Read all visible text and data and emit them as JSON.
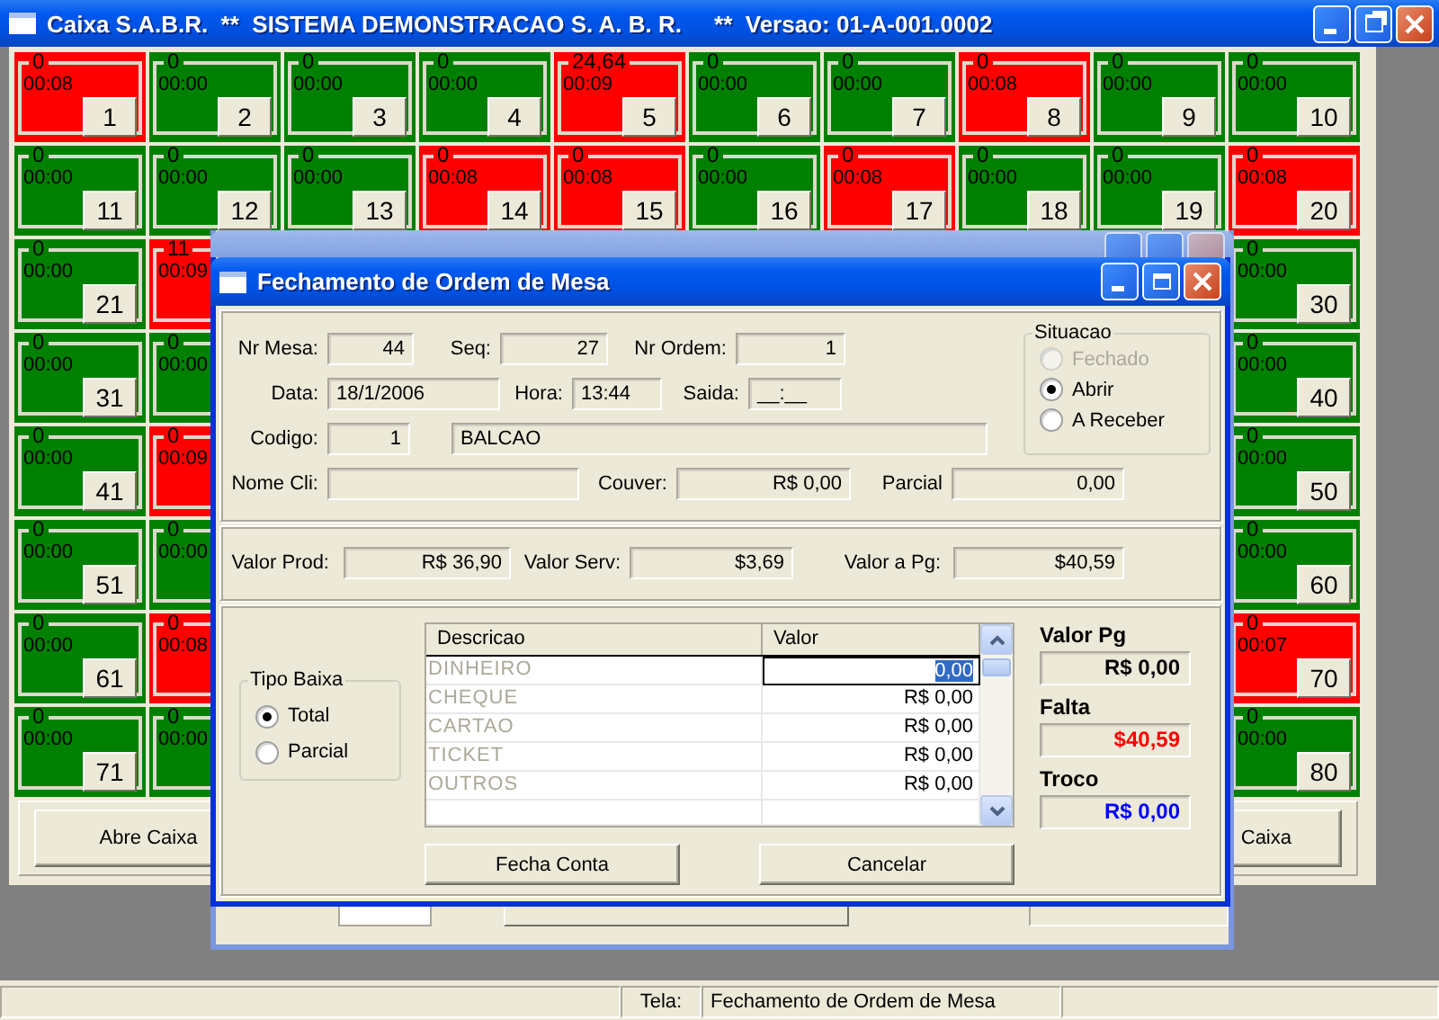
{
  "window": {
    "title": "Caixa S.A.B.R.  **  SISTEMA DEMONSTRACAO S. A. B. R.     **  Versao: 01-A-001.0002"
  },
  "table_rows": [
    {
      "tables": [
        {
          "total": "0",
          "time": "00:08",
          "number": "1",
          "color": "#ff0000"
        },
        {
          "total": "0",
          "time": "00:00",
          "number": "2",
          "color": "#008000"
        },
        {
          "total": "0",
          "time": "00:00",
          "number": "3",
          "color": "#008000"
        },
        {
          "total": "0",
          "time": "00:00",
          "number": "4",
          "color": "#008000"
        },
        {
          "total": "24,64",
          "time": "00:09",
          "number": "5",
          "color": "#ff0000"
        },
        {
          "total": "0",
          "time": "00:00",
          "number": "6",
          "color": "#008000"
        },
        {
          "total": "0",
          "time": "00:00",
          "number": "7",
          "color": "#008000"
        },
        {
          "total": "0",
          "time": "00:08",
          "number": "8",
          "color": "#ff0000"
        },
        {
          "total": "0",
          "time": "00:00",
          "number": "9",
          "color": "#008000"
        },
        {
          "total": "0",
          "time": "00:00",
          "number": "10",
          "color": "#008000"
        }
      ]
    },
    {
      "tables": [
        {
          "total": "0",
          "time": "00:00",
          "number": "11",
          "color": "#008000"
        },
        {
          "total": "0",
          "time": "00:00",
          "number": "12",
          "color": "#008000"
        },
        {
          "total": "0",
          "time": "00:00",
          "number": "13",
          "color": "#008000"
        },
        {
          "total": "0",
          "time": "00:08",
          "number": "14",
          "color": "#ff0000"
        },
        {
          "total": "0",
          "time": "00:08",
          "number": "15",
          "color": "#ff0000"
        },
        {
          "total": "0",
          "time": "00:00",
          "number": "16",
          "color": "#008000"
        },
        {
          "total": "0",
          "time": "00:08",
          "number": "17",
          "color": "#ff0000"
        },
        {
          "total": "0",
          "time": "00:00",
          "number": "18",
          "color": "#008000"
        },
        {
          "total": "0",
          "time": "00:00",
          "number": "19",
          "color": "#008000"
        },
        {
          "total": "0",
          "time": "00:08",
          "number": "20",
          "color": "#ff0000"
        }
      ]
    },
    {
      "tables": [
        {
          "total": "0",
          "time": "00:00",
          "number": "21",
          "color": "#008000"
        },
        {
          "total": "11",
          "time": "00:09",
          "color": "#ff0000"
        },
        {
          "total": "0",
          "time": "00:00",
          "number": "30",
          "color": "#008000"
        }
      ]
    },
    {
      "tables": [
        {
          "total": "0",
          "time": "00:00",
          "number": "31",
          "color": "#008000"
        },
        {
          "total": "0",
          "time": "00:00",
          "color": "#008000"
        },
        {
          "total": "0",
          "time": "00:00",
          "number": "40",
          "color": "#008000"
        }
      ]
    },
    {
      "tables": [
        {
          "total": "0",
          "time": "00:00",
          "number": "41",
          "color": "#008000"
        },
        {
          "total": "0",
          "time": "00:09",
          "color": "#ff0000"
        },
        {
          "total": "0",
          "time": "00:00",
          "number": "50",
          "color": "#008000"
        }
      ]
    },
    {
      "tables": [
        {
          "total": "0",
          "time": "00:00",
          "number": "51",
          "color": "#008000"
        },
        {
          "total": "0",
          "time": "00:00",
          "color": "#008000"
        },
        {
          "total": "0",
          "time": "00:00",
          "number": "60",
          "color": "#008000"
        }
      ]
    },
    {
      "tables": [
        {
          "total": "0",
          "time": "00:00",
          "number": "61",
          "color": "#008000"
        },
        {
          "total": "0",
          "time": "00:08",
          "color": "#ff0000"
        },
        {
          "total": "0",
          "time": "00:07",
          "number": "70",
          "color": "#ff0000"
        }
      ]
    },
    {
      "tables": [
        {
          "total": "0",
          "time": "00:00",
          "number": "71",
          "color": "#008000"
        },
        {
          "total": "0",
          "time": "00:00",
          "color": "#008000"
        },
        {
          "total": "0",
          "time": "00:00",
          "number": "80",
          "color": "#008000"
        }
      ]
    }
  ],
  "buttons": [
    "Abre Caixa",
    "Caixa"
  ],
  "dialog": {
    "title": "Fechamento de Ordem de Mesa",
    "nr_mesa": {
      "label": "Nr Mesa:",
      "value": "44"
    },
    "seq": {
      "label": "Seq:",
      "value": "27"
    },
    "nr_ordem": {
      "label": "Nr Ordem:",
      "value": "1"
    },
    "data": {
      "label": "Data:",
      "value": "18/1/2006"
    },
    "hora": {
      "label": "Hora:",
      "value": "13:44"
    },
    "saida": {
      "label": "Saida:",
      "value": "__:__"
    },
    "codigo": {
      "label": "Codigo:",
      "value": "1",
      "name": "BALCAO"
    },
    "nome_cli": {
      "label": "Nome Cli:"
    },
    "couver": {
      "label": "Couver:",
      "value": "R$ 0,00"
    },
    "parcial": {
      "label": "Parcial",
      "value": "0,00"
    },
    "situacao": {
      "title": "Situacao",
      "options": [
        {
          "label": "Fechado",
          "selected": false,
          "disabled": true
        },
        {
          "label": "Abrir",
          "selected": true,
          "disabled": false
        },
        {
          "label": "A Receber",
          "selected": false,
          "disabled": false
        }
      ]
    },
    "valor_prod": {
      "label": "Valor Prod:",
      "value": "R$ 36,90"
    },
    "valor_serv": {
      "label": "Valor Serv:",
      "value": "$3,69"
    },
    "valor_a_pg": {
      "label": "Valor a Pg:",
      "value": "$40,59"
    },
    "tipo_baixa": {
      "title": "Tipo Baixa",
      "options": [
        {
          "label": "Total",
          "selected": true
        },
        {
          "label": "Parcial",
          "selected": false
        }
      ]
    },
    "payments": {
      "columns": [
        "Descricao",
        "Valor"
      ],
      "rows": [
        {
          "descricao": "DINHEIRO",
          "valor": "0,00",
          "selected": true
        },
        {
          "descricao": "CHEQUE",
          "valor": "R$ 0,00",
          "selected": false
        },
        {
          "descricao": "CARTAO",
          "valor": "R$ 0,00",
          "selected": false
        },
        {
          "descricao": "TICKET",
          "valor": "R$ 0,00",
          "selected": false
        },
        {
          "descricao": "OUTROS",
          "valor": "R$ 0,00",
          "selected": false
        }
      ]
    },
    "valor_pg": {
      "label": "Valor Pg",
      "value": "R$ 0,00"
    },
    "falta": {
      "label": "Falta",
      "value": "$40,59"
    },
    "troco": {
      "label": "Troco",
      "value": "R$ 0,00"
    },
    "buttons": [
      "Fecha Conta",
      "Cancelar"
    ]
  },
  "status_bar": {
    "label": "Tela:",
    "screen": "Fechamento de Ordem de Mesa"
  }
}
